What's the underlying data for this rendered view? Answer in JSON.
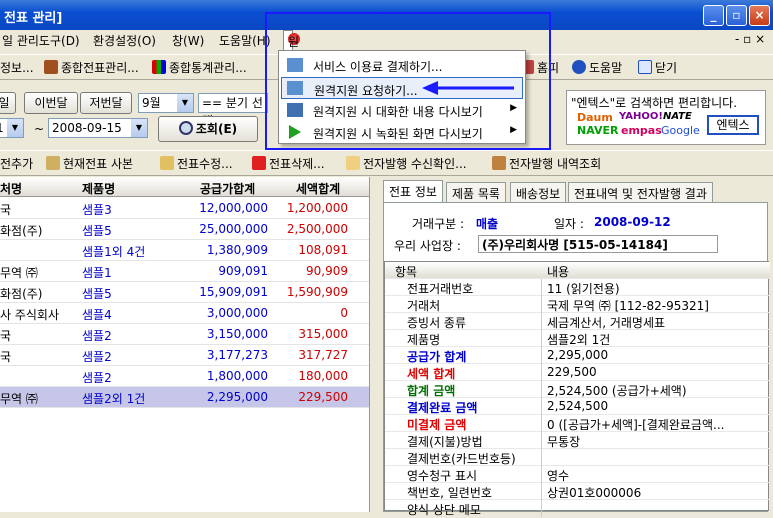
{
  "window": {
    "title": "전표 관리]"
  },
  "menubar": {
    "items": [
      "일 관리도구(D)",
      "환경설정(O)",
      "창(W)",
      "도움말(H)"
    ],
    "active": "원격지원(S)",
    "right": "- ▫ ×"
  },
  "toolbar1": {
    "items": [
      "정보...",
      "종합전표관리...",
      "종합통계관리...",
      "홈피",
      "도움말",
      "닫기"
    ]
  },
  "filter": {
    "btn_day": "일",
    "btn_prev_month": "이번달",
    "btn_last_month": "저번달",
    "month_value": "9월",
    "quarter_value": "== 분기 선택 ==",
    "date_from": "1",
    "tilde": "~",
    "date_to": "2008-09-15",
    "search_label": "조회(E)"
  },
  "searchbox": {
    "hint": "\"엔텍스\"로 검색하면 편리합니다.",
    "keyword": "엔텍스",
    "logos": [
      "Daum",
      "NAVER",
      "YAHOO!",
      "empas",
      "NATE",
      "Google"
    ]
  },
  "toolbar2": {
    "items": [
      "전추가",
      "현재전표 사본",
      "전표수정...",
      "전표삭제...",
      "전자발행 수신확인...",
      "전자발행 내역조회"
    ]
  },
  "grid": {
    "headers": [
      "처명",
      "제품명",
      "공급가합계",
      "세액합계"
    ],
    "rows": [
      {
        "c": "국",
        "p": "샘플3",
        "a": "12,000,000",
        "t": "1,200,000"
      },
      {
        "c": "화점(주)",
        "p": "샘플5",
        "a": "25,000,000",
        "t": "2,500,000"
      },
      {
        "c": "",
        "p": "샘플1외 4건",
        "a": "1,380,909",
        "t": "108,091"
      },
      {
        "c": "무역 ㈜",
        "p": "샘플1",
        "a": "909,091",
        "t": "90,909"
      },
      {
        "c": "화점(주)",
        "p": "샘플5",
        "a": "15,909,091",
        "t": "1,590,909"
      },
      {
        "c": "사 주식회사",
        "p": "샘플4",
        "a": "3,000,000",
        "t": "0"
      },
      {
        "c": "국",
        "p": "샘플2",
        "a": "3,150,000",
        "t": "315,000"
      },
      {
        "c": "국",
        "p": "샘플2",
        "a": "3,177,273",
        "t": "317,727"
      },
      {
        "c": "",
        "p": "샘플2",
        "a": "1,800,000",
        "t": "180,000"
      },
      {
        "c": "무역 ㈜",
        "p": "샘플2외 1건",
        "a": "2,295,000",
        "t": "229,500"
      }
    ]
  },
  "detail": {
    "tabs": [
      "전표 정보",
      "제품 목록",
      "배송정보",
      "전표내역 및 전자발행 결과"
    ],
    "trade_type_label": "거래구분 :",
    "trade_type": "매출",
    "date_label": "일자 :",
    "date": "2008-09-12",
    "company_label": "우리 사업장 :",
    "company": "(주)우리회사명 [515-05-14184]",
    "prop_headers": [
      "항목",
      "내용"
    ],
    "props": [
      {
        "k": "전표거래번호",
        "v": "11 (읽기전용)"
      },
      {
        "k": "거래처",
        "v": "국제 무역 ㈜ [112-82-95321]"
      },
      {
        "k": "증빙서 종류",
        "v": "세금계산서, 거래명세표"
      },
      {
        "k": "제품명",
        "v": "샘플2외 1건"
      },
      {
        "k": "공급가 합계",
        "v": "2,295,000"
      },
      {
        "k": "세액 합계",
        "v": "229,500"
      },
      {
        "k": "합계 금액",
        "v": "2,524,500 (공급가+세액)"
      },
      {
        "k": "결제완료 금액",
        "v": "2,524,500"
      },
      {
        "k": "미결제 금액",
        "v": "0 ([공급가+세액]-[결제완료금액..."
      },
      {
        "k": "결제(지불)방법",
        "v": "무통장"
      },
      {
        "k": "결제번호(카드번호등)",
        "v": ""
      },
      {
        "k": "영수청구 표시",
        "v": "영수"
      },
      {
        "k": "책번호, 일련번호",
        "v": "상권01호000006"
      },
      {
        "k": "양식 상단 메모",
        "v": ""
      }
    ]
  },
  "popup": {
    "items": [
      "서비스 이용료 결제하기...",
      "원격지원 요청하기...",
      "원격지원 시 대화한 내용 다시보기",
      "원격지원 시 녹화된 화면 다시보기"
    ]
  },
  "colors": {
    "accent": "#0a4fd1",
    "highlight": "#1a1aff",
    "red": "#e00000",
    "blue": "#0000cc",
    "green": "#007000"
  }
}
